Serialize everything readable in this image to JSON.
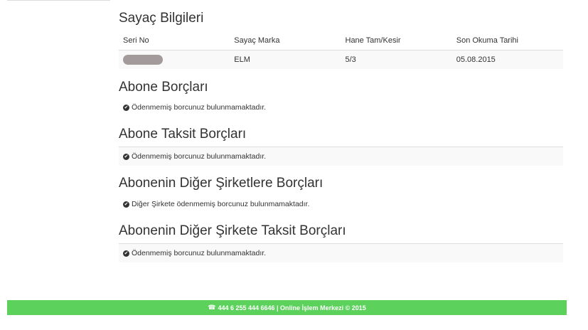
{
  "meter": {
    "title": "Sayaç Bilgileri",
    "headers": [
      "Seri No",
      "Sayaç Marka",
      "Hane Tam/Kesir",
      "Son Okuma Tarihi"
    ],
    "row": {
      "brand": "ELM",
      "hane": "5/3",
      "date": "05.08.2015"
    }
  },
  "sections": [
    {
      "title": "Abone Borçları",
      "message": "Ödenmemiş borcunuz bulunmamaktadır."
    },
    {
      "title": "Abone Taksit Borçları",
      "message": "Ödenmemiş borcunuz bulunmamaktadır."
    },
    {
      "title": "Abonenin Diğer Şirketlere Borçları",
      "message": "Diğer Şirkete ödenmemiş borcunuz bulunmamaktadır."
    },
    {
      "title": "Abonenin Diğer Şirkete Taksit Borçları",
      "message": "Ödenmemiş borcunuz bulunmamaktadır."
    }
  ],
  "icons": {
    "status": "check-circle-icon",
    "phone": "phone-icon"
  },
  "footer": {
    "text": "444 6 255 444 6646 | Online İşlem Merkezi © 2015"
  },
  "colors": {
    "footer_bg": "#5cd25c",
    "masked": "#a39b9b"
  }
}
